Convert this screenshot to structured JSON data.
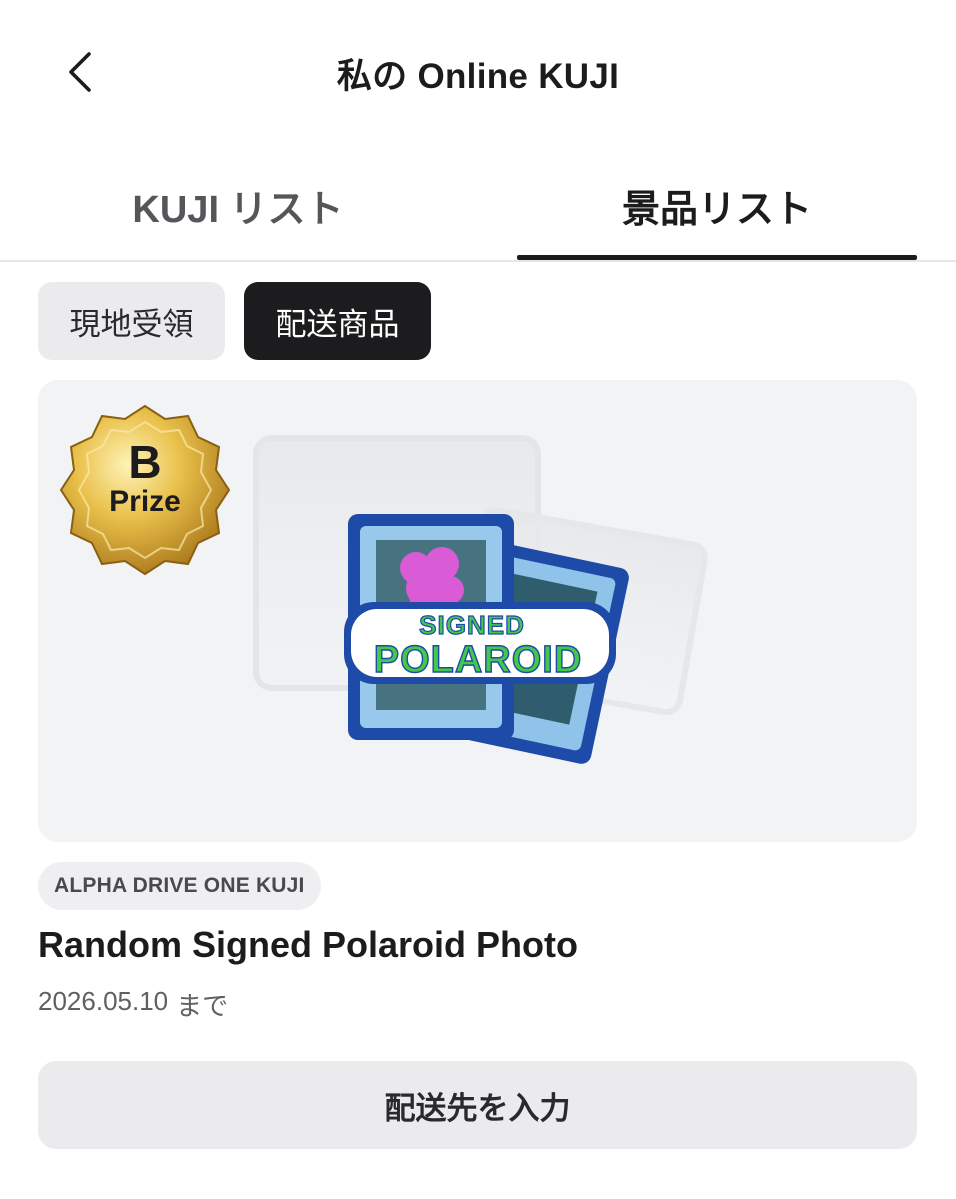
{
  "header": {
    "title": "私の Online KUJI",
    "back_icon": "chevron-left-icon"
  },
  "tabs": [
    {
      "label": "KUJI リスト",
      "active": false
    },
    {
      "label": "景品リスト",
      "active": true
    }
  ],
  "filters": [
    {
      "label": "現地受領",
      "selected": false
    },
    {
      "label": "配送商品",
      "selected": true
    }
  ],
  "prize": {
    "badge_letter": "B",
    "badge_word": "Prize",
    "patch_line1": "SIGNED",
    "patch_line2": "POLAROID",
    "tag": "ALPHA DRIVE ONE KUJI",
    "name": "Random Signed Polaroid Photo",
    "deadline_date": "2026.05.10",
    "deadline_suffix": "まで"
  },
  "actions": {
    "address_button": "配送先を入力"
  },
  "colors": {
    "active": "#1c1c1e",
    "chip_inactive": "#ebebed",
    "card_bg": "#f2f3f5",
    "badge_gold": "#d4a72c",
    "patch_blue": "#1f4ba8",
    "patch_green": "#43c84a",
    "patch_pink": "#d95bd6"
  }
}
